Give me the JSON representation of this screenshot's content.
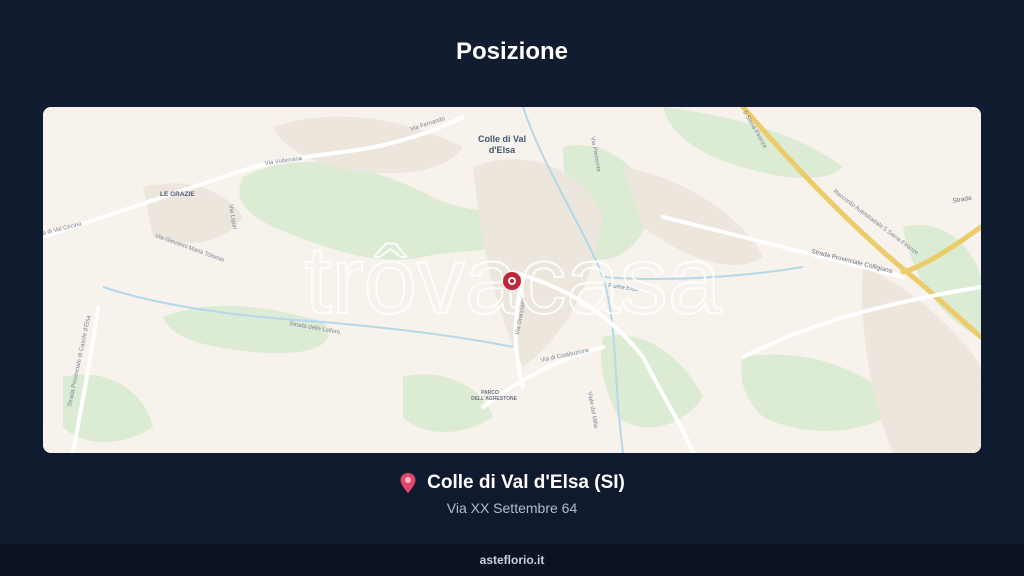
{
  "page": {
    "title": "Posizione"
  },
  "map": {
    "watermark": "trôvacasa",
    "labels": {
      "town": "Colle di Val",
      "town2": "d'Elsa",
      "le_grazie": "LE GRAZIE",
      "via_volterrana": "Via Volterrana",
      "via_fernando": "Via Fernando",
      "via_val_cecina": "a di Val Cecina",
      "via_liguri": "Via Liguri",
      "via_giovanni": "Via Giovanni Maria Tolomei",
      "strada_casole": "Strada Provinciale di Casole d'Elsa",
      "strada_lellere": "Strada delle Lellere",
      "via_gracciano": "Via Gracciano",
      "via_costituzione": "Via di Costituzione",
      "parco": "PARCO",
      "parco2": "DELL'AGRESTONE",
      "viale_milia": "Viale del Milia",
      "fiume_elsa": "Fiume Elsa",
      "via_piemonte": "Via Piemonte",
      "strada_colligiana": "Strada Provinciale Colligiana",
      "raccordo": "Raccordo Autostradale 5 Siena-Firenze",
      "raccordo_top": "5 Siena-Firenze",
      "strada_right": "Strada"
    },
    "colors": {
      "background": "#f7f2ec",
      "green": "#d9ead0",
      "motorway": "#eed27a",
      "road": "#ffffff",
      "river": "#a9d3e8",
      "pin": "#c0253a"
    }
  },
  "location": {
    "pin_icon": "map-pin-icon",
    "name": "Colle di Val d'Elsa (SI)",
    "address": "Via XX Settembre 64"
  },
  "footer": {
    "text": "asteflorio.it"
  }
}
